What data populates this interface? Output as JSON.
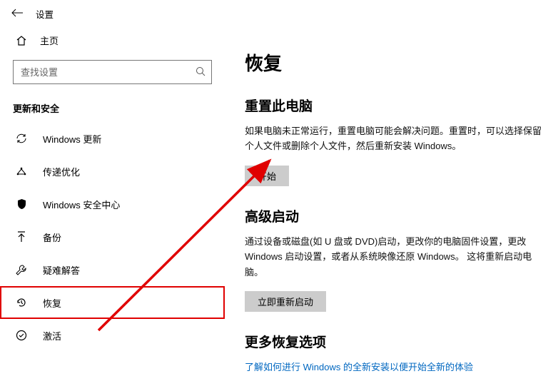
{
  "header": {
    "title": "设置"
  },
  "home": {
    "label": "主页"
  },
  "search": {
    "placeholder": "查找设置"
  },
  "sidebar": {
    "heading": "更新和安全",
    "items": [
      {
        "label": "Windows 更新"
      },
      {
        "label": "传递优化"
      },
      {
        "label": "Windows 安全中心"
      },
      {
        "label": "备份"
      },
      {
        "label": "疑难解答"
      },
      {
        "label": "恢复"
      },
      {
        "label": "激活"
      }
    ]
  },
  "content": {
    "page_title": "恢复",
    "s1_title": "重置此电脑",
    "s1_body": "如果电脑未正常运行，重置电脑可能会解决问题。重置时，可以选择保留个人文件或删除个人文件，然后重新安装 Windows。",
    "s1_btn": "开始",
    "s2_title": "高级启动",
    "s2_body": "通过设备或磁盘(如 U 盘或 DVD)启动，更改你的电脑固件设置，更改Windows 启动设置，或者从系统映像还原 Windows。 这将重新启动电脑。",
    "s2_btn": "立即重新启动",
    "s3_title": "更多恢复选项",
    "s3_link": "了解如何进行 Windows 的全新安装以便开始全新的体验"
  }
}
